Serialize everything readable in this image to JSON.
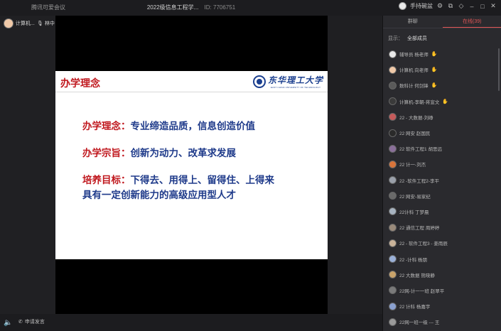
{
  "titlebar": {
    "app_name": "腾讯可爱会议",
    "meeting_title": "2022级信息工程学...",
    "meeting_id": "ID: 7706751",
    "user_name": "手持碗盆"
  },
  "speakers": {
    "current": "计算机...",
    "other": "林中"
  },
  "slide": {
    "title": "办学理念",
    "logo_text": "东华理工大学",
    "logo_subtext": "EAST CHINA UNIVERSITY OF TECHNOLOGY",
    "lines": [
      {
        "label": "办学理念：",
        "text": "专业缔造品质，信息创造价值"
      },
      {
        "label": "办学宗旨：",
        "text": "创新为动力、改革求发展"
      },
      {
        "label": "培养目标：",
        "text": "下得去、用得上、留得住、上得来"
      }
    ],
    "line3_cont": "具有一定创新能力的高级应用型人才"
  },
  "bottombar": {
    "hand_label": "申请发言"
  },
  "panel": {
    "tab_chat": "群聊",
    "tab_online": "在线(39)",
    "filter_label": "显示：",
    "filter_value": "全部成员",
    "members": [
      {
        "name": "辅导员 杨老师",
        "hand": true,
        "color": "#e9e9e9"
      },
      {
        "name": "计算机 向老师",
        "hand": true,
        "color": "#f0c9a8"
      },
      {
        "name": "数科计 何剑锋",
        "hand": true,
        "color": "#5a5a5a"
      },
      {
        "name": "计算机-李朝-蒋宣文",
        "hand": true,
        "color": "#3a3a3a"
      },
      {
        "name": "22 - 大数据-刘峥",
        "hand": false,
        "color": "#c65a5a"
      },
      {
        "name": "22 网安 赵国民",
        "hand": false,
        "color": "#2a2a2a"
      },
      {
        "name": "22 软件工程1 胡思远",
        "hand": false,
        "color": "#8a6f9a"
      },
      {
        "name": "22 计一-刘杰",
        "hand": false,
        "color": "#d8743a"
      },
      {
        "name": "22 -软件工程2-李平",
        "hand": false,
        "color": "#9aa0aa"
      },
      {
        "name": "22 网安-易家纪",
        "hand": false,
        "color": "#6a6a6a"
      },
      {
        "name": "22计科 丁梦晨",
        "hand": false,
        "color": "#a7b3c0"
      },
      {
        "name": "22 通信工程 周婷婷",
        "hand": false,
        "color": "#9a8a7a"
      },
      {
        "name": "22 - 软件工程3 - 姜雨辰",
        "hand": false,
        "color": "#c9b39a"
      },
      {
        "name": "22 -计科 杨朋",
        "hand": false,
        "color": "#9ab0d8"
      },
      {
        "name": "22 大数据 熊晓静",
        "hand": false,
        "color": "#c9a36a"
      },
      {
        "name": "22网-计一一班 赵翠平",
        "hand": false,
        "color": "#7a7a7a"
      },
      {
        "name": "22 计科 杨嘉宇",
        "hand": false,
        "color": "#8aa0d0"
      },
      {
        "name": "22网一班一级 --- 王",
        "hand": false,
        "color": "#9a9a9a"
      }
    ]
  }
}
